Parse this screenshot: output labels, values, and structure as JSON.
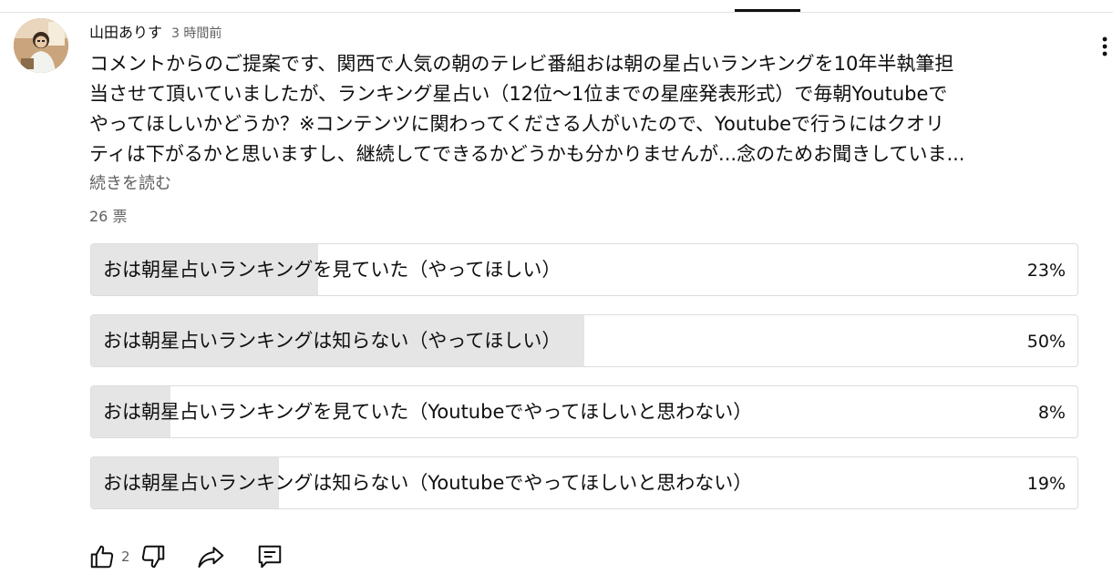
{
  "post": {
    "author": "山田ありす",
    "time": "3 時間前",
    "text_lines": [
      "コメントからのご提案です、関西で人気の朝のテレビ番組おは朝の星占いランキングを10年半執筆担",
      "当させて頂いていましたが、ランキング星占い（12位〜1位までの星座発表形式）で毎朝Youtubeで",
      "やってほしいかどうか？※コンテンツに関わってくださる人がいたので、Youtubeで行うにはクオリ",
      "ティは下がるかと思いますし、継続してできるかどうかも分かりませんが...念のためお聞きしていま..."
    ],
    "read_more": "続きを読む",
    "votes": "26 票"
  },
  "poll": {
    "options": [
      {
        "label": "おは朝星占いランキングを見ていた（やってほしい）",
        "percent_text": "23%",
        "percent": 23
      },
      {
        "label": "おは朝星占いランキングは知らない（やってほしい）",
        "percent_text": "50%",
        "percent": 50
      },
      {
        "label": "おは朝星占いランキングを見ていた（Youtubeでやってほしいと思わない）",
        "percent_text": "8%",
        "percent": 8
      },
      {
        "label": "おは朝星占いランキングは知らない（Youtubeでやってほしいと思わない）",
        "percent_text": "19%",
        "percent": 19
      }
    ],
    "fill_color": "#e5e5e5",
    "border_color": "#dcdcdc"
  },
  "actions": {
    "like_count": "2",
    "icons": [
      "thumbs-up-icon",
      "thumbs-down-icon",
      "share-icon",
      "comment-icon"
    ]
  },
  "menu_icon": "more-vertical-icon"
}
